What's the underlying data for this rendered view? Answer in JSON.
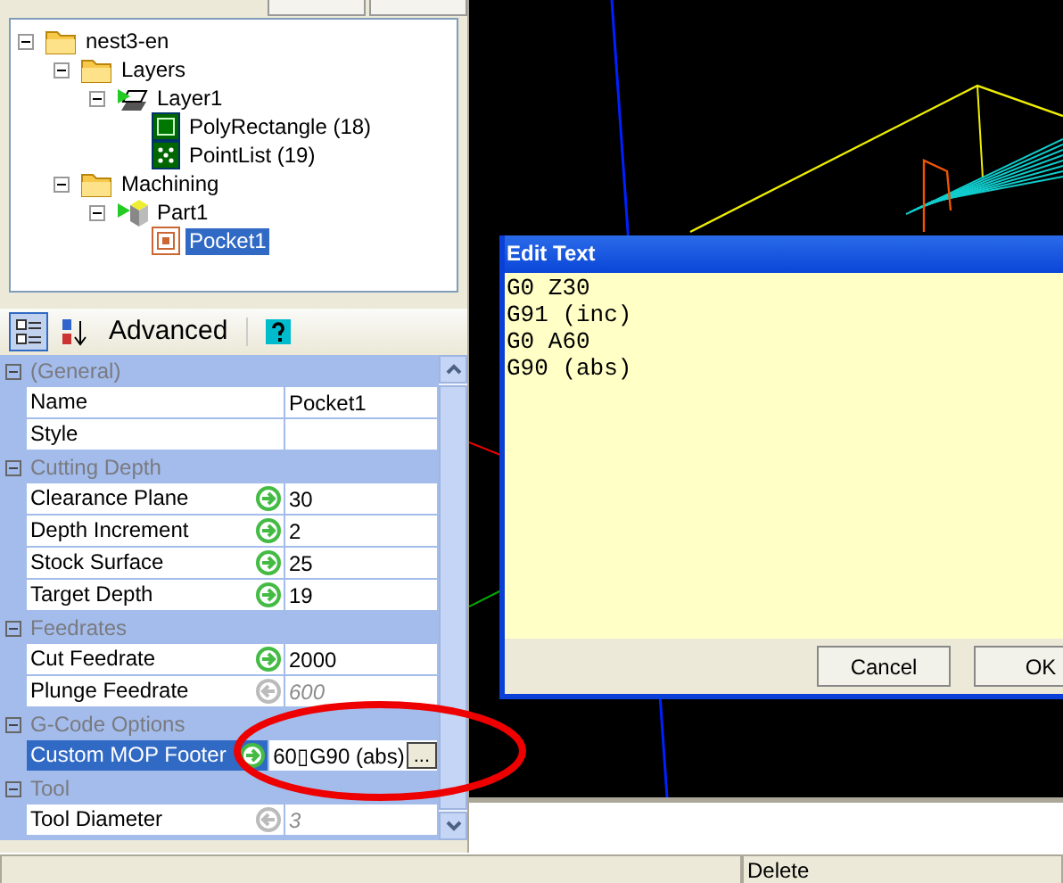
{
  "tree": [
    {
      "label": "nest3-en",
      "kind": "folder",
      "expanded": true,
      "selected": false,
      "children": [
        {
          "label": "Layers",
          "kind": "folder",
          "expanded": true,
          "selected": false,
          "children": [
            {
              "label": "Layer1",
              "kind": "layer",
              "expanded": true,
              "selected": false,
              "children": [
                {
                  "label": "PolyRectangle (18)",
                  "kind": "rectangle",
                  "selected": false
                },
                {
                  "label": "PointList (19)",
                  "kind": "points",
                  "selected": false
                }
              ]
            }
          ]
        },
        {
          "label": "Machining",
          "kind": "folder",
          "expanded": true,
          "selected": false,
          "children": [
            {
              "label": "Part1",
              "kind": "part",
              "expanded": true,
              "selected": false,
              "children": [
                {
                  "label": "Pocket1",
                  "kind": "pocket",
                  "selected": true
                }
              ]
            }
          ]
        }
      ]
    }
  ],
  "toolbar": {
    "categorized_selected": true,
    "mode_label": "Advanced"
  },
  "properties": [
    {
      "kind": "category",
      "label": "(General)",
      "expanded": true
    },
    {
      "kind": "property",
      "name": "Name",
      "value": "Pocket1",
      "selected": false
    },
    {
      "kind": "property",
      "name": "Style",
      "selected": false
    },
    {
      "kind": "category",
      "label": "Cutting Depth",
      "expanded": true
    },
    {
      "kind": "property",
      "name": "Clearance Plane",
      "value": "30",
      "overridden": true,
      "selected": false
    },
    {
      "kind": "property",
      "name": "Depth Increment",
      "value": "2",
      "overridden": true,
      "selected": false
    },
    {
      "kind": "property",
      "name": "Stock Surface",
      "value": "25",
      "overridden": true,
      "selected": false
    },
    {
      "kind": "property",
      "name": "Target Depth",
      "value": "19",
      "overridden": true,
      "selected": false
    },
    {
      "kind": "category",
      "label": "Feedrates",
      "expanded": true
    },
    {
      "kind": "property",
      "name": "Cut Feedrate",
      "value": "2000",
      "overridden": true,
      "selected": false
    },
    {
      "kind": "property",
      "name": "Plunge Feedrate",
      "value": "600",
      "overridden": false,
      "selected": false
    },
    {
      "kind": "category",
      "label": "G-Code Options",
      "expanded": true
    },
    {
      "kind": "property",
      "name": "Custom MOP Footer",
      "value": "60▯G90 (abs)",
      "overridden": true,
      "selected": true,
      "button": "..."
    },
    {
      "kind": "category",
      "label": "Tool",
      "expanded": true
    },
    {
      "kind": "property",
      "name": "Tool Diameter",
      "value": "3",
      "overridden": false,
      "selected": false
    }
  ],
  "dialog": {
    "title": "Edit Text",
    "text": "G0 Z30\nG91 (inc)\nG0 A60\nG90 (abs)",
    "buttons": [
      "Cancel",
      "OK"
    ]
  },
  "status_bar": {
    "message": "Delete"
  }
}
